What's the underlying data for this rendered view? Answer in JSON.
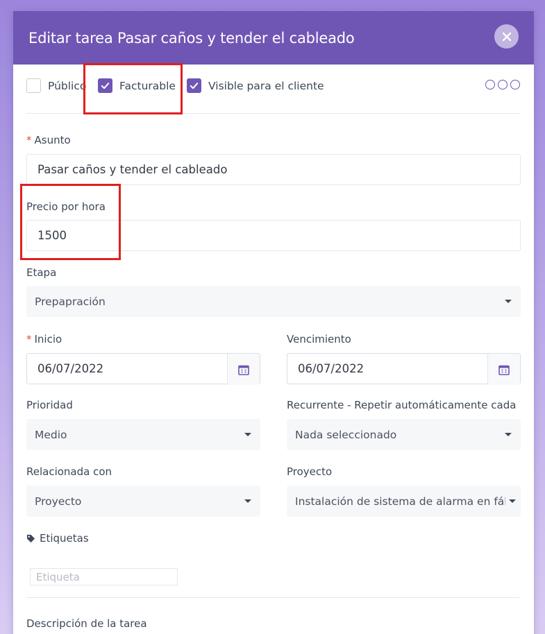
{
  "modal": {
    "title": "Editar tarea Pasar caños y tender el cableado",
    "close_icon": "close-icon"
  },
  "checkboxes": [
    {
      "label": "Público",
      "checked": false
    },
    {
      "label": "Facturable",
      "checked": true
    },
    {
      "label": "Visible para el cliente",
      "checked": true
    }
  ],
  "more_icon": "more-options-icon",
  "fields": {
    "asunto": {
      "label": "Asunto",
      "required": true,
      "value": "Pasar caños y tender el cableado"
    },
    "precio": {
      "label": "Precio por hora",
      "value": "1500"
    },
    "etapa": {
      "label": "Etapa",
      "value": "Prepapración"
    },
    "inicio": {
      "label": "Inicio",
      "required": true,
      "value": "06/07/2022"
    },
    "vencimiento": {
      "label": "Vencimiento",
      "value": "06/07/2022"
    },
    "prioridad": {
      "label": "Prioridad",
      "value": "Medio"
    },
    "recurrente": {
      "label": "Recurrente - Repetir automáticamente cada",
      "value": "Nada seleccionado"
    },
    "relacionada": {
      "label": "Relacionada con",
      "value": "Proyecto"
    },
    "proyecto": {
      "label": "Proyecto",
      "value": "Instalación de sistema de alarma en fáb"
    },
    "etiquetas": {
      "label": "Etiquetas",
      "placeholder": "Etiqueta"
    },
    "descripcion": {
      "label": "Descripción de la tarea"
    }
  },
  "colors": {
    "accent": "#6f56b4",
    "required": "#e74c3c",
    "highlight": "#e01f1f"
  }
}
